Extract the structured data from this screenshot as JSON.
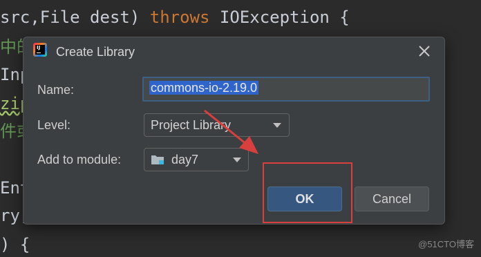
{
  "editor": {
    "line1_a": "src,File dest) ",
    "line1_kw": "throws",
    "line1_b": " IOException {",
    "line2": "中的",
    "line3": "Inp",
    "line4": "zip",
    "line5": "件或",
    "line6": "Ent",
    "line7": "ry)",
    "line8": ") {"
  },
  "dialog": {
    "title": "Create Library",
    "name_label": "Name:",
    "name_value": "commons-io-2.19.0",
    "level_label": "Level:",
    "level_value": "Project Library",
    "module_label": "Add to module:",
    "module_value": "day7",
    "ok_label": "OK",
    "cancel_label": "Cancel"
  },
  "icons": {
    "app": "intellij-idea-icon",
    "close": "close-icon",
    "folder": "module-folder-icon",
    "dropdown": "chevron-down-icon"
  },
  "colors": {
    "annotation": "#d9403d",
    "accent": "#365880",
    "selection": "#2f65ca"
  },
  "watermark": "@51CTO博客"
}
